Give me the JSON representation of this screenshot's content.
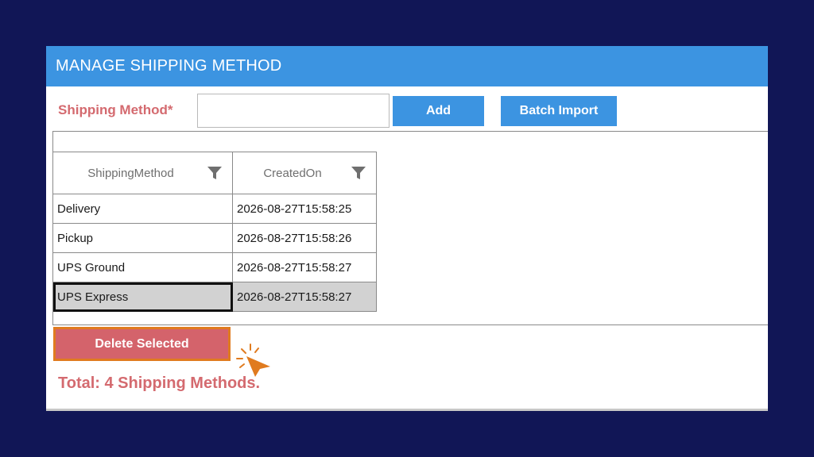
{
  "window": {
    "title": "MANAGE SHIPPING METHOD"
  },
  "form": {
    "label": "Shipping Method*",
    "input_value": "",
    "add_label": "Add",
    "import_label": "Batch Import"
  },
  "grid": {
    "columns": [
      "ShippingMethod",
      "CreatedOn"
    ],
    "rows": [
      [
        "Delivery",
        "2026-08-27T15:58:25"
      ],
      [
        "Pickup",
        "2026-08-27T15:58:26"
      ],
      [
        "UPS Ground",
        "2026-08-27T15:58:27"
      ],
      [
        "UPS Express",
        "2026-08-27T15:58:27"
      ]
    ],
    "selected_row": 3
  },
  "actions": {
    "delete_label": "Delete Selected"
  },
  "footer": {
    "total_text": "Total: 4 Shipping Methods."
  },
  "icons": {
    "filter": "filter-icon",
    "cursor": "pointer-cursor-icon"
  },
  "colors": {
    "background": "#111656",
    "accent": "#3c94e1",
    "label": "#d46a6f",
    "danger": "#d4636b",
    "highlight": "#e07b1f"
  }
}
